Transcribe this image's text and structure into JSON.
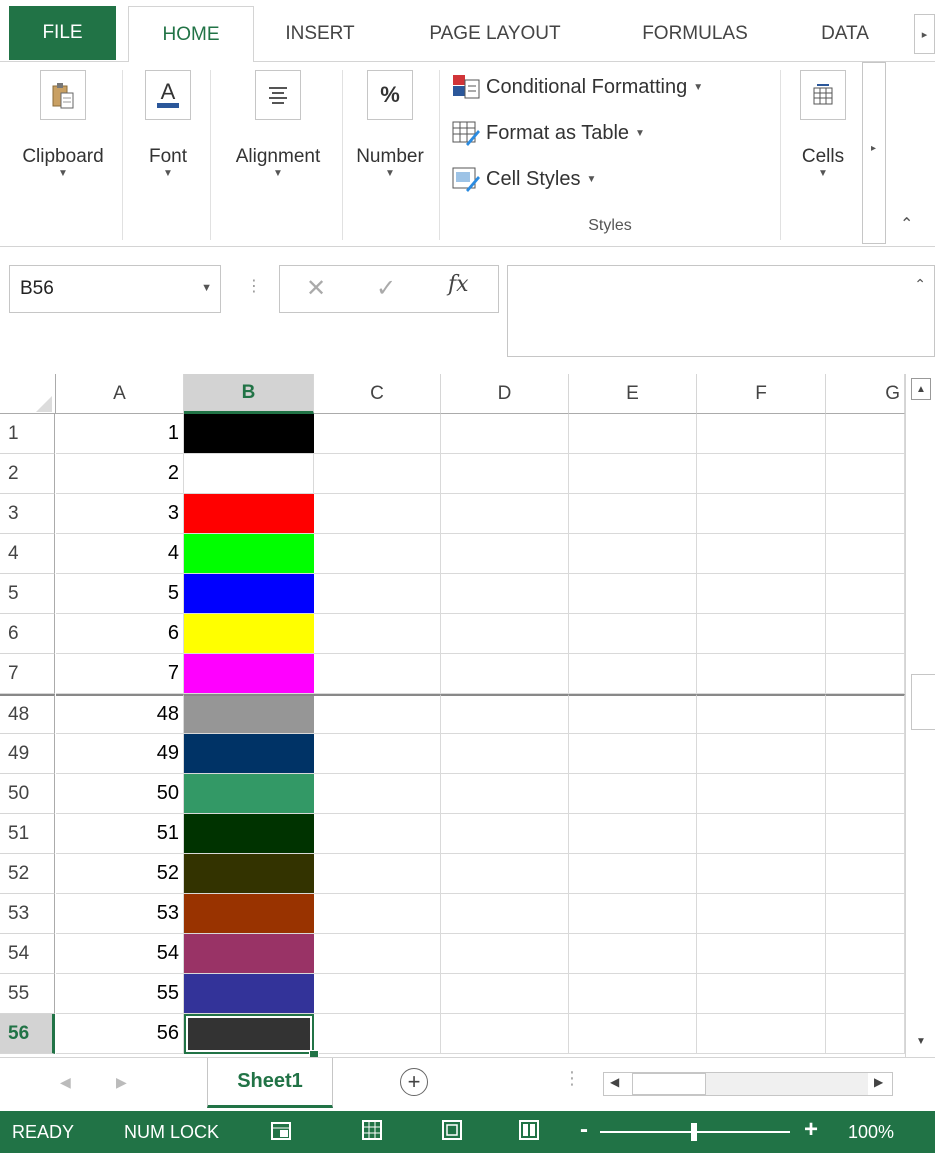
{
  "ribbon_tabs": {
    "file": "FILE",
    "home": "HOME",
    "insert": "INSERT",
    "page_layout": "PAGE LAYOUT",
    "formulas": "FORMULAS",
    "data": "DATA"
  },
  "ribbon": {
    "clipboard": "Clipboard",
    "font": "Font",
    "alignment": "Alignment",
    "number": "Number",
    "number_icon": "%",
    "conditional_formatting": "Conditional Formatting",
    "format_as_table": "Format as Table",
    "cell_styles": "Cell Styles",
    "styles_group": "Styles",
    "cells": "Cells"
  },
  "formula_bar": {
    "name_box": "B56",
    "fx": "fx",
    "formula_value": ""
  },
  "columns": [
    "A",
    "B",
    "C",
    "D",
    "E",
    "F",
    "G"
  ],
  "selected_column": "B",
  "rows": [
    {
      "num": "1",
      "a": "1",
      "b_color": "#000000"
    },
    {
      "num": "2",
      "a": "2",
      "b_color": "#ffffff"
    },
    {
      "num": "3",
      "a": "3",
      "b_color": "#ff0000"
    },
    {
      "num": "4",
      "a": "4",
      "b_color": "#00ff00"
    },
    {
      "num": "5",
      "a": "5",
      "b_color": "#0000ff"
    },
    {
      "num": "6",
      "a": "6",
      "b_color": "#ffff00"
    },
    {
      "num": "7",
      "a": "7",
      "b_color": "#ff00ff"
    },
    {
      "num": "48",
      "a": "48",
      "b_color": "#969696"
    },
    {
      "num": "49",
      "a": "49",
      "b_color": "#003366"
    },
    {
      "num": "50",
      "a": "50",
      "b_color": "#339966"
    },
    {
      "num": "51",
      "a": "51",
      "b_color": "#003300"
    },
    {
      "num": "52",
      "a": "52",
      "b_color": "#333300"
    },
    {
      "num": "53",
      "a": "53",
      "b_color": "#993300"
    },
    {
      "num": "54",
      "a": "54",
      "b_color": "#993366"
    },
    {
      "num": "55",
      "a": "55",
      "b_color": "#333399"
    },
    {
      "num": "56",
      "a": "56",
      "b_color": "#333333"
    }
  ],
  "selected_row": "56",
  "sheet_tab": "Sheet1",
  "status": {
    "ready": "READY",
    "num_lock": "NUM LOCK",
    "zoom": "100%"
  },
  "colors": {
    "accent": "#217346"
  }
}
